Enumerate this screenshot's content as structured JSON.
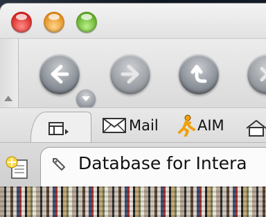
{
  "window": {
    "controls": [
      "close",
      "minimize",
      "zoom"
    ]
  },
  "toolbar": {
    "buttons": [
      {
        "name": "back",
        "icon": "arrow-left-icon",
        "enabled": true
      },
      {
        "name": "forward",
        "icon": "arrow-right-icon",
        "enabled": false
      },
      {
        "name": "up",
        "icon": "arrow-up-left-icon",
        "enabled": true
      },
      {
        "name": "stop",
        "icon": "close-icon",
        "enabled": false
      }
    ]
  },
  "bookmarks": {
    "items": [
      {
        "label": "Mail",
        "icon": "envelope-icon"
      },
      {
        "label": "AIM",
        "icon": "aim-runner-icon"
      }
    ]
  },
  "tabs": {
    "active_title": "Database for Intera"
  },
  "colors": {
    "close": "#d4241e",
    "minimize": "#e08a18",
    "zoom": "#5fa823",
    "aim_orange": "#f0a010"
  }
}
